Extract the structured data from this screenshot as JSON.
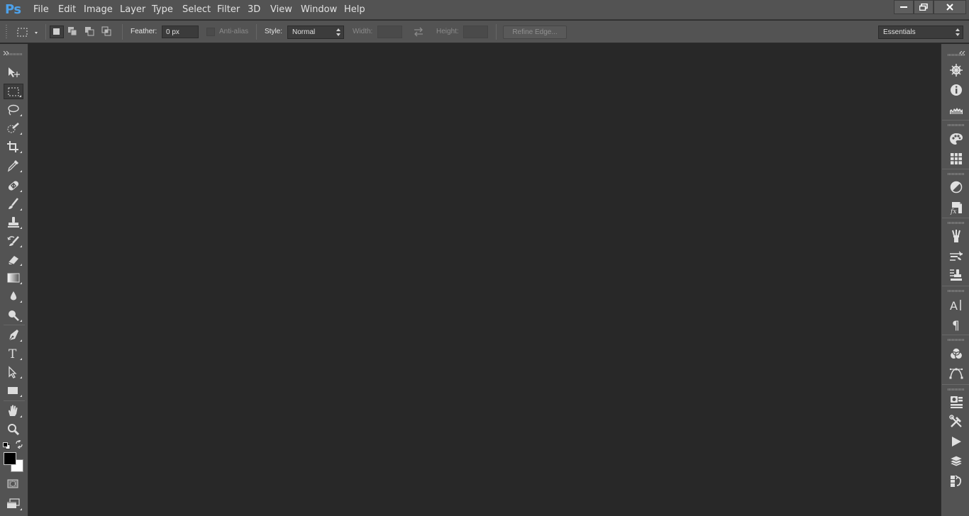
{
  "app": {
    "logo": "Ps"
  },
  "menu": [
    "File",
    "Edit",
    "Image",
    "Layer",
    "Type",
    "Select",
    "Filter",
    "3D",
    "View",
    "Window",
    "Help"
  ],
  "window_controls": [
    "minimize-icon",
    "restore-icon",
    "close-icon"
  ],
  "options": {
    "feather_label": "Feather:",
    "feather_value": "0 px",
    "antialias_label": "Anti-alias",
    "style_label": "Style:",
    "style_value": "Normal",
    "width_label": "Width:",
    "height_label": "Height:",
    "refine_edge_label": "Refine Edge...",
    "workspace_value": "Essentials"
  },
  "tools": [
    "move-tool",
    "rectangular-marquee-tool",
    "lasso-tool",
    "quick-selection-tool",
    "crop-tool",
    "eyedropper-tool",
    "spot-healing-brush-tool",
    "brush-tool",
    "clone-stamp-tool",
    "history-brush-tool",
    "eraser-tool",
    "gradient-tool",
    "blur-tool",
    "dodge-tool",
    "pen-tool",
    "type-tool",
    "path-selection-tool",
    "rectangle-tool",
    "hand-tool",
    "zoom-tool"
  ],
  "colors": {
    "foreground": "#000000",
    "background": "#ffffff",
    "accent": "#4da1ea",
    "chrome": "#535353",
    "workspace": "#282828"
  },
  "right_panels": [
    "navigator-icon",
    "info-icon",
    "histogram-icon",
    "color-icon",
    "swatches-icon",
    "adjustments-icon",
    "styles-icon",
    "brush-presets-icon",
    "brush-icon",
    "clone-source-icon",
    "character-icon",
    "paragraph-icon",
    "channels-icon",
    "paths-icon",
    "properties-icon",
    "tool-presets-icon",
    "actions-icon",
    "layers-icon",
    "history-icon"
  ]
}
